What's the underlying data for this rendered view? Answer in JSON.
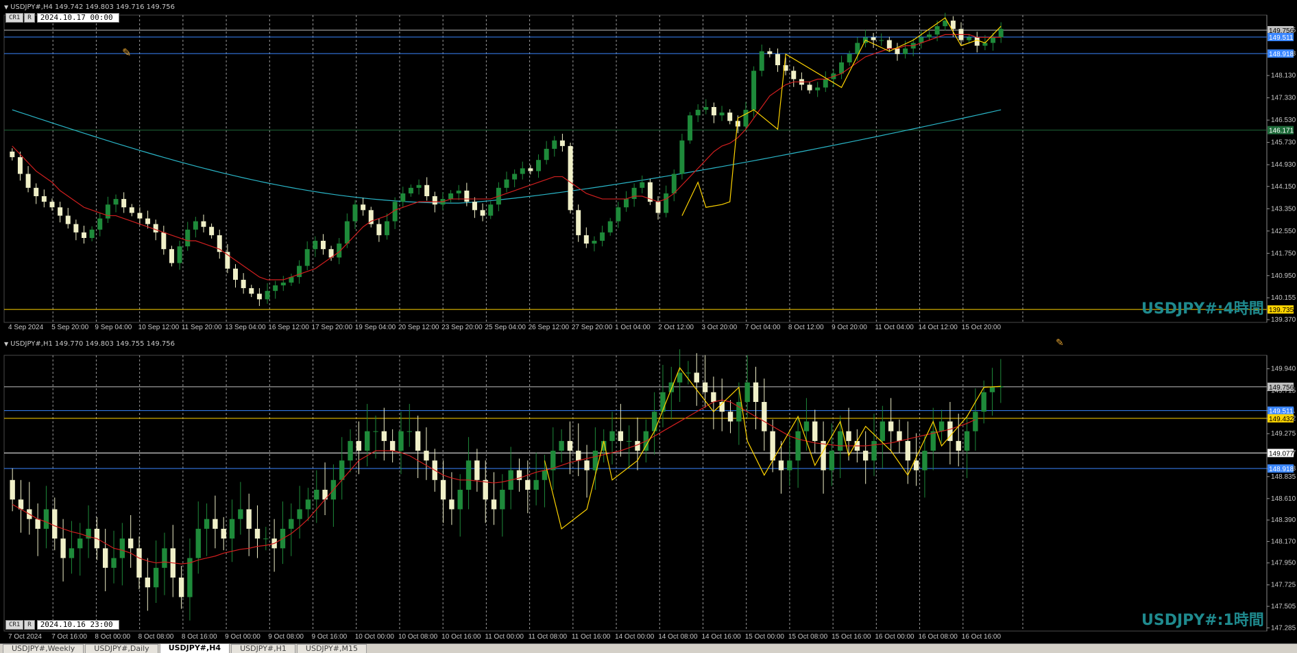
{
  "h4": {
    "info": "USDJPY#,H4  149.742 149.803 149.716 149.756",
    "ctl": {
      "btn1": "CR1",
      "btn2": "R",
      "date": "2024.10.17 00:00"
    },
    "watermark": "USDJPY#:4時間",
    "price_ticks": [
      "149.755",
      "148.918",
      "148.130",
      "147.330",
      "146.530",
      "145.730",
      "144.930",
      "144.150",
      "143.350",
      "142.550",
      "141.750",
      "140.950",
      "140.155",
      "139.370"
    ],
    "price_min": 139.37,
    "price_max": 150.2,
    "time_labels": [
      "4 Sep 2024",
      "5 Sep 20:00",
      "9 Sep 04:00",
      "10 Sep 12:00",
      "11 Sep 20:00",
      "13 Sep 04:00",
      "16 Sep 12:00",
      "17 Sep 20:00",
      "19 Sep 04:00",
      "20 Sep 12:00",
      "23 Sep 20:00",
      "25 Sep 04:00",
      "26 Sep 12:00",
      "27 Sep 20:00",
      "1 Oct 04:00",
      "2 Oct 12:00",
      "3 Oct 20:00",
      "7 Oct 04:00",
      "8 Oct 12:00",
      "9 Oct 20:00",
      "11 Oct 04:00",
      "14 Oct 12:00",
      "15 Oct 20:00"
    ],
    "hlines": [
      {
        "price": "149.756",
        "color": "#c0c0c0",
        "label_bg": "#c0c0c0",
        "label_fg": "#000"
      },
      {
        "price": "149.511",
        "color": "#3a86ff",
        "label_bg": "#3a86ff",
        "label_fg": "#fff"
      },
      {
        "price": "148.918",
        "color": "#3a86ff",
        "label_bg": "#3a86ff",
        "label_fg": "#fff"
      },
      {
        "price": "146.171",
        "color": "#1e6b3a",
        "label_bg": "#1e6b3a",
        "label_fg": "#fff"
      },
      {
        "price": "139.735",
        "color": "#ffd400",
        "label_bg": "#ffd400",
        "label_fg": "#000"
      }
    ],
    "closes": [
      145.2,
      144.6,
      144.1,
      143.8,
      143.6,
      143.4,
      143.1,
      142.8,
      142.5,
      142.3,
      142.6,
      143.0,
      143.5,
      143.7,
      143.4,
      143.2,
      143.0,
      142.8,
      142.5,
      141.9,
      141.4,
      142.0,
      142.6,
      142.9,
      142.7,
      142.4,
      141.8,
      141.2,
      140.8,
      140.5,
      140.3,
      140.1,
      140.4,
      140.6,
      140.7,
      140.9,
      141.3,
      141.9,
      142.2,
      141.9,
      141.6,
      142.1,
      142.9,
      143.5,
      143.3,
      142.8,
      142.4,
      142.9,
      143.6,
      143.9,
      144.1,
      144.2,
      143.8,
      143.5,
      143.7,
      143.9,
      144.0,
      143.6,
      143.3,
      143.1,
      143.5,
      144.1,
      144.4,
      144.6,
      144.8,
      144.7,
      145.1,
      145.5,
      145.8,
      145.6,
      143.3,
      142.4,
      142.1,
      142.2,
      142.5,
      142.9,
      143.4,
      143.7,
      144.1,
      144.3,
      143.6,
      143.2,
      143.9,
      144.6,
      145.8,
      146.7,
      146.9,
      147.0,
      146.7,
      146.8,
      146.5,
      146.3,
      146.9,
      148.3,
      149.0,
      148.9,
      148.5,
      148.3,
      148.0,
      147.8,
      147.6,
      147.7,
      148.0,
      148.2,
      148.6,
      148.9,
      149.3,
      149.5,
      149.4,
      149.4,
      149.1,
      148.9,
      149.1,
      149.3,
      149.5,
      149.6,
      149.9,
      150.1,
      149.8,
      149.4,
      149.5,
      149.2,
      149.3,
      149.5,
      149.8
    ],
    "ma_fast": [
      145.6,
      145.3,
      145.0,
      144.7,
      144.5,
      144.3,
      144.0,
      143.8,
      143.6,
      143.4,
      143.3,
      143.2,
      143.1,
      143.1,
      143.0,
      142.9,
      142.8,
      142.7,
      142.6,
      142.5,
      142.4,
      142.3,
      142.2,
      142.2,
      142.1,
      142.0,
      141.9,
      141.7,
      141.5,
      141.3,
      141.1,
      140.9,
      140.8,
      140.8,
      140.8,
      140.9,
      141.0,
      141.1,
      141.2,
      141.4,
      141.6,
      141.8,
      142.1,
      142.4,
      142.7,
      142.9,
      143.0,
      143.1,
      143.3,
      143.4,
      143.5,
      143.6,
      143.6,
      143.6,
      143.6,
      143.7,
      143.7,
      143.7,
      143.7,
      143.7,
      143.7,
      143.8,
      143.9,
      144.0,
      144.1,
      144.2,
      144.3,
      144.4,
      144.5,
      144.5,
      144.3,
      144.1,
      143.9,
      143.8,
      143.7,
      143.7,
      143.7,
      143.7,
      143.8,
      143.8,
      143.7,
      143.6,
      143.7,
      143.9,
      144.2,
      144.5,
      144.8,
      145.1,
      145.4,
      145.6,
      145.7,
      145.9,
      146.2,
      146.6,
      147.0,
      147.4,
      147.6,
      147.8,
      147.9,
      147.9,
      147.9,
      148.0,
      148.0,
      148.1,
      148.2,
      148.4,
      148.6,
      148.8,
      148.9,
      149.0,
      149.1,
      149.1,
      149.2,
      149.2,
      149.3,
      149.4,
      149.5,
      149.6,
      149.6,
      149.6,
      149.6,
      149.5,
      149.5,
      149.5,
      149.5
    ],
    "ma_slow_start": 146.9,
    "ma_slow_mid": 143.55,
    "ma_slow_end": 146.9,
    "zigzag": [
      [
        84,
        143.1
      ],
      [
        86,
        144.3
      ],
      [
        87,
        143.4
      ],
      [
        89,
        143.5
      ],
      [
        90,
        143.6
      ],
      [
        91,
        146.6
      ],
      [
        93,
        146.9
      ],
      [
        96,
        146.2
      ],
      [
        97,
        148.9
      ],
      [
        104,
        147.7
      ],
      [
        107,
        149.4
      ],
      [
        110,
        149.0
      ],
      [
        113,
        149.4
      ],
      [
        117,
        150.2
      ],
      [
        119,
        149.2
      ],
      [
        121,
        149.4
      ],
      [
        122,
        149.3
      ],
      [
        124,
        149.9
      ]
    ]
  },
  "h1": {
    "info": "USDJPY#,H1  149.770 149.803 149.755 149.756",
    "ctl": {
      "btn1": "CR1",
      "btn2": "R",
      "date": "2024.10.16 23:00"
    },
    "watermark": "USDJPY#:1時間",
    "price_ticks": [
      "149.940",
      "149.715",
      "149.511",
      "149.432",
      "149.275",
      "149.077",
      "148.918",
      "148.835",
      "148.610",
      "148.390",
      "148.170",
      "147.950",
      "147.725",
      "147.505",
      "147.285"
    ],
    "price_min": 147.28,
    "price_max": 150.05,
    "time_labels": [
      "7 Oct 2024",
      "7 Oct 16:00",
      "8 Oct 00:00",
      "8 Oct 08:00",
      "8 Oct 16:00",
      "9 Oct 00:00",
      "9 Oct 08:00",
      "9 Oct 16:00",
      "10 Oct 00:00",
      "10 Oct 08:00",
      "10 Oct 16:00",
      "11 Oct 00:00",
      "11 Oct 08:00",
      "11 Oct 16:00",
      "14 Oct 00:00",
      "14 Oct 08:00",
      "14 Oct 16:00",
      "15 Oct 00:00",
      "15 Oct 08:00",
      "15 Oct 16:00",
      "16 Oct 00:00",
      "16 Oct 08:00",
      "16 Oct 16:00"
    ],
    "hlines": [
      {
        "price": "149.756",
        "color": "#c0c0c0",
        "label_bg": "#c0c0c0",
        "label_fg": "#000"
      },
      {
        "price": "149.511",
        "color": "#3a86ff",
        "label_bg": "#3a86ff",
        "label_fg": "#fff"
      },
      {
        "price": "149.432",
        "color": "#ffd400",
        "label_bg": "#ffd400",
        "label_fg": "#000"
      },
      {
        "price": "149.077",
        "color": "#ffffff",
        "label_bg": "#ffffff",
        "label_fg": "#000"
      },
      {
        "price": "148.918",
        "color": "#3a86ff",
        "label_bg": "#3a86ff",
        "label_fg": "#fff"
      }
    ],
    "closes": [
      148.6,
      148.5,
      148.4,
      148.3,
      148.5,
      148.2,
      148.0,
      148.1,
      148.2,
      148.3,
      148.1,
      147.9,
      148.0,
      148.2,
      148.1,
      147.8,
      147.7,
      147.9,
      148.1,
      147.8,
      147.6,
      148.0,
      148.3,
      148.4,
      148.3,
      148.2,
      148.4,
      148.5,
      148.3,
      148.2,
      148.2,
      148.1,
      148.3,
      148.4,
      148.5,
      148.6,
      148.7,
      148.6,
      148.8,
      149.0,
      149.2,
      149.1,
      149.3,
      149.3,
      149.2,
      149.1,
      149.3,
      149.3,
      149.1,
      149.0,
      148.8,
      148.6,
      148.5,
      148.7,
      149.0,
      148.8,
      148.6,
      148.5,
      148.7,
      148.9,
      148.8,
      148.7,
      148.8,
      148.9,
      149.1,
      149.2,
      149.1,
      149.0,
      148.9,
      149.1,
      149.2,
      149.3,
      149.2,
      149.2,
      149.1,
      149.3,
      149.5,
      149.7,
      149.8,
      149.9,
      149.9,
      149.8,
      149.7,
      149.6,
      149.5,
      149.4,
      149.6,
      149.8,
      149.6,
      149.3,
      149.0,
      148.9,
      149.0,
      149.3,
      149.4,
      149.2,
      148.9,
      149.1,
      149.3,
      149.2,
      149.1,
      149.0,
      149.2,
      149.4,
      149.3,
      149.2,
      149.0,
      148.9,
      149.1,
      149.3,
      149.4,
      149.2,
      149.1,
      149.3,
      149.5,
      149.7,
      149.75,
      149.76
    ],
    "ma_fast": [
      148.55,
      148.5,
      148.45,
      148.4,
      148.37,
      148.33,
      148.3,
      148.27,
      148.25,
      148.22,
      148.2,
      148.15,
      148.1,
      148.08,
      148.05,
      148.0,
      147.97,
      147.95,
      147.96,
      147.95,
      147.94,
      147.95,
      147.98,
      148.0,
      148.02,
      148.05,
      148.07,
      148.09,
      148.1,
      148.12,
      148.13,
      148.15,
      148.2,
      148.25,
      148.32,
      148.4,
      148.5,
      148.6,
      148.7,
      148.8,
      148.9,
      149.0,
      149.05,
      149.1,
      149.1,
      149.1,
      149.08,
      149.05,
      149.0,
      148.95,
      148.9,
      148.85,
      148.82,
      148.8,
      148.8,
      148.79,
      148.78,
      148.77,
      148.78,
      148.8,
      148.82,
      148.85,
      148.88,
      148.9,
      148.92,
      148.95,
      148.98,
      149.0,
      149.02,
      149.04,
      149.06,
      149.08,
      149.1,
      149.13,
      149.16,
      149.2,
      149.25,
      149.3,
      149.35,
      149.4,
      149.45,
      149.5,
      149.55,
      149.6,
      149.62,
      149.6,
      149.55,
      149.5,
      149.45,
      149.4,
      149.35,
      149.3,
      149.25,
      149.22,
      149.2,
      149.18,
      149.17,
      149.16,
      149.15,
      149.15,
      149.15,
      149.15,
      149.16,
      149.17,
      149.18,
      149.2,
      149.22,
      149.24,
      149.26,
      149.28,
      149.3,
      149.32,
      149.35,
      149.38,
      149.42
    ],
    "zigzag": [
      [
        63,
        149.0
      ],
      [
        65,
        148.3
      ],
      [
        68,
        148.5
      ],
      [
        70,
        149.2
      ],
      [
        71,
        148.8
      ],
      [
        74,
        149.0
      ],
      [
        76,
        149.3
      ],
      [
        79,
        149.95
      ],
      [
        83,
        149.5
      ],
      [
        86,
        149.75
      ],
      [
        87,
        149.2
      ],
      [
        89,
        148.85
      ],
      [
        93,
        149.45
      ],
      [
        95,
        148.95
      ],
      [
        98,
        149.4
      ],
      [
        99,
        149.05
      ],
      [
        101,
        149.35
      ],
      [
        104,
        149.1
      ],
      [
        106,
        148.85
      ],
      [
        109,
        149.4
      ],
      [
        110,
        149.15
      ],
      [
        113,
        149.45
      ],
      [
        115,
        149.75
      ],
      [
        117,
        149.76
      ]
    ]
  },
  "tabs": [
    "USDJPY#,Weekly",
    "USDJPY#,Daily",
    "USDJPY#,H4",
    "USDJPY#,H1",
    "USDJPY#,M15"
  ],
  "active_tab": "USDJPY#,H4",
  "colors": {
    "bull": "#1e8a3a",
    "bear": "#f0f0c8",
    "ma_fast": "#d21f1f",
    "ma_slow": "#2ab7c9",
    "zigzag": "#ffd400",
    "grid": "#5a5a5a"
  }
}
